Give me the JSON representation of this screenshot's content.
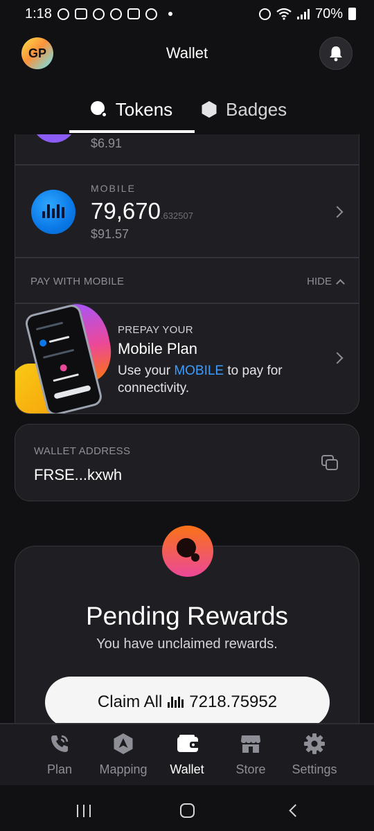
{
  "status_bar": {
    "time": "1:18",
    "battery": "70%"
  },
  "header": {
    "avatar_initials": "GP",
    "title": "Wallet"
  },
  "tabs": [
    {
      "label": "Tokens",
      "active": true
    },
    {
      "label": "Badges",
      "active": false
    }
  ],
  "tokens": {
    "previous": {
      "usd": "$6.91",
      "color": "#8b5cf6"
    },
    "mobile": {
      "label": "MOBILE",
      "amount": "79,670",
      "decimals": ".632507",
      "usd": "$91.57",
      "color": "#0a78e6"
    }
  },
  "pay_section": {
    "label": "PAY WITH MOBILE",
    "hide_label": "HIDE"
  },
  "promo": {
    "eyebrow": "PREPAY YOUR",
    "title": "Mobile Plan",
    "body_prefix": "Use your ",
    "body_accent": "MOBILE",
    "body_suffix": " to pay for connectivity.",
    "accent_color": "#3b9bff"
  },
  "wallet_address": {
    "label": "WALLET ADDRESS",
    "value": "FRSE...kxwh"
  },
  "rewards": {
    "title": "Pending Rewards",
    "subtitle": "You have unclaimed rewards.",
    "claim_label": "Claim All",
    "claim_amount": "7218.75952"
  },
  "bottom_nav": [
    {
      "label": "Plan",
      "icon": "phone-icon",
      "active": false
    },
    {
      "label": "Mapping",
      "icon": "hexagon-arrow-icon",
      "active": false
    },
    {
      "label": "Wallet",
      "icon": "wallet-icon",
      "active": true
    },
    {
      "label": "Store",
      "icon": "store-icon",
      "active": false
    },
    {
      "label": "Settings",
      "icon": "gear-icon",
      "active": false
    }
  ]
}
